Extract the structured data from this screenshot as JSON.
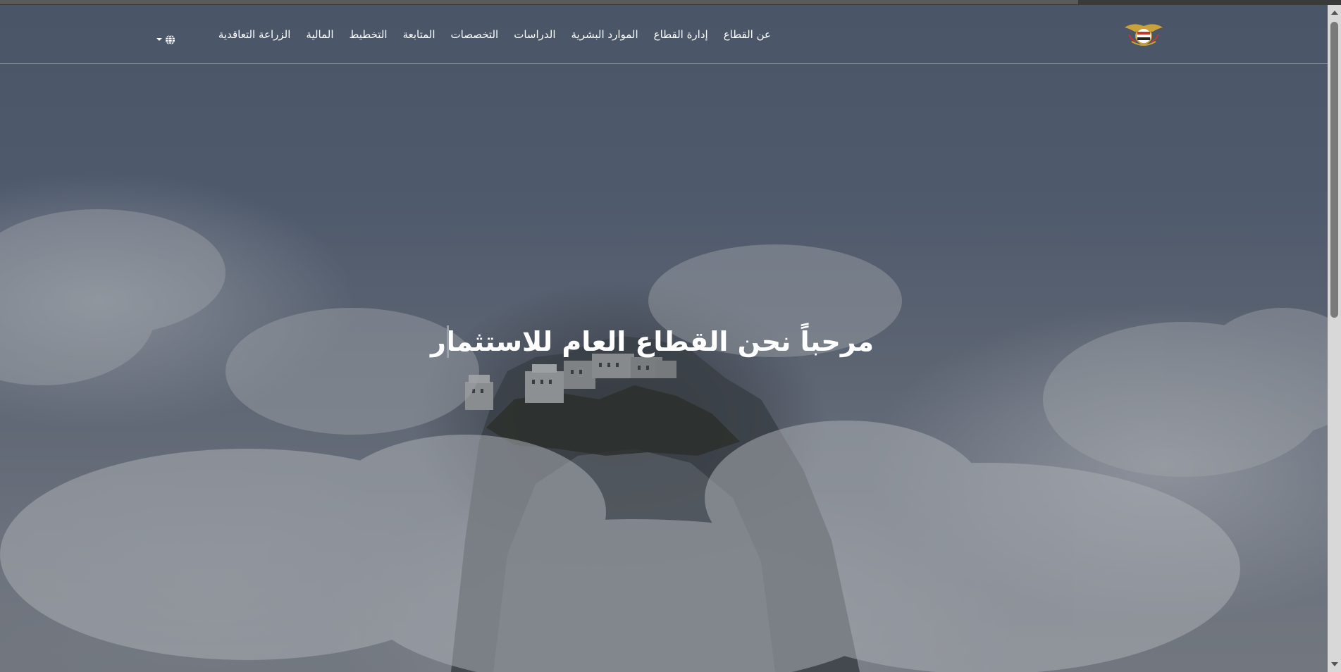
{
  "navbar": {
    "logo_icon": "yemen-emblem-icon",
    "items": [
      {
        "label": "عن القطاع"
      },
      {
        "label": "إدارة القطاع"
      },
      {
        "label": "الموارد البشرية"
      },
      {
        "label": "الدراسات"
      },
      {
        "label": "التخصصات"
      },
      {
        "label": "المتابعة"
      },
      {
        "label": "التخطيط"
      },
      {
        "label": "المالية"
      },
      {
        "label": "الزراعة التعاقدية"
      }
    ],
    "language_icon": "globe-icon"
  },
  "hero": {
    "title": "مرحباً نحن القطاع العام للاستثمار",
    "background": "mountain-castle-in-clouds"
  },
  "colors": {
    "nav_text": "#ffffff",
    "overlay": "#4a5568",
    "title_text": "#ffffff"
  }
}
